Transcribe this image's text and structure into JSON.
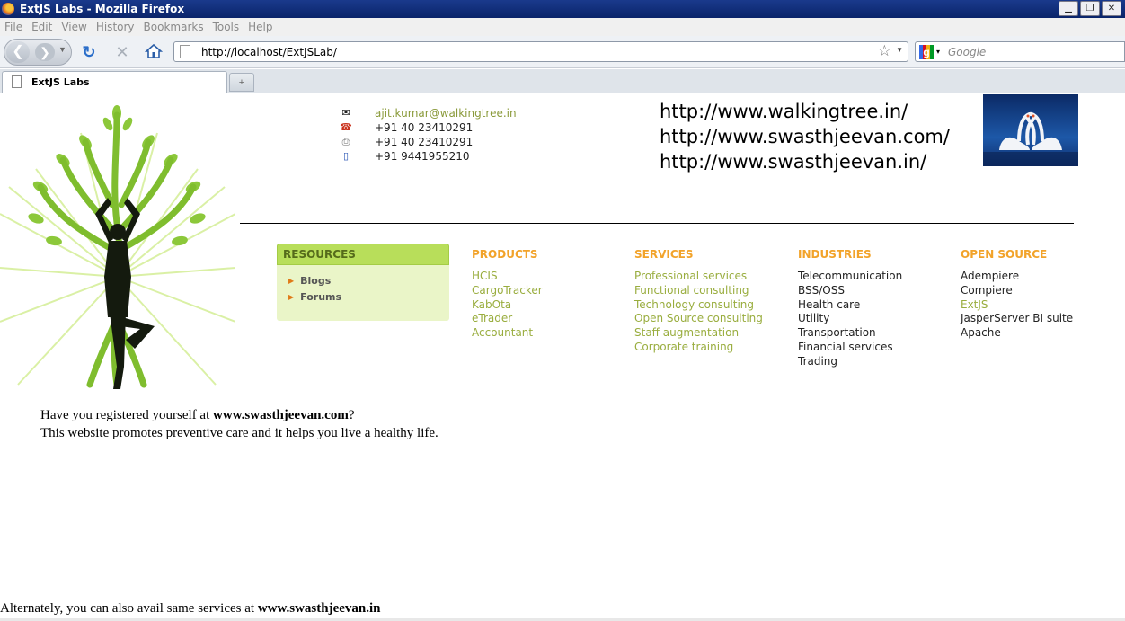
{
  "window": {
    "title": "ExtJS Labs - Mozilla Firefox"
  },
  "menu": [
    "File",
    "Edit",
    "View",
    "History",
    "Bookmarks",
    "Tools",
    "Help"
  ],
  "address_bar": {
    "url": "http://localhost/ExtJSLab/"
  },
  "search_bar": {
    "placeholder": "Google"
  },
  "tab": {
    "label": "ExtJS Labs"
  },
  "contact": {
    "email": "ajit.kumar@walkingtree.in",
    "phone": "+91 40 23410291",
    "fax": "+91 40 23410291",
    "mobile": "+91 9441955210"
  },
  "sites": [
    "http://www.walkingtree.in/",
    "http://www.swasthjeevan.com/",
    "http://www.swasthjeevan.in/"
  ],
  "resources": {
    "title": "RESOURCES",
    "items": [
      "Blogs",
      "Forums"
    ]
  },
  "products": {
    "title": "PRODUCTS",
    "items": [
      "HCIS",
      "CargoTracker",
      "KabOta",
      "eTrader",
      "Accountant"
    ]
  },
  "services": {
    "title": "SERVICES",
    "items": [
      "Professional services",
      "Functional consulting",
      "Technology consulting",
      "Open Source consulting",
      "Staff augmentation",
      "Corporate training"
    ]
  },
  "industries": {
    "title": "INDUSTRIES",
    "items": [
      "Telecommunication",
      "BSS/OSS",
      "Health care",
      "Utility",
      "Transportation",
      "Financial services",
      "Trading"
    ]
  },
  "open_source": {
    "title": "OPEN SOURCE",
    "items": [
      "Adempiere",
      "Compiere",
      "ExtJS",
      "JasperServer BI suite",
      "Apache"
    ]
  },
  "promo": {
    "line1_prefix": "Have you registered yourself at ",
    "line1_link": "www.swasthjeevan.com",
    "line1_suffix": "?",
    "line2": "This website promotes preventive care and it helps you live a healthy life."
  },
  "footer": {
    "prefix": "Alternately, you can also avail same services at ",
    "link": "www.swasthjeevan.in"
  },
  "colors": {
    "accent_orange": "#f2a32a",
    "green": "#b8de5a",
    "link_green": "#99ad3e"
  }
}
